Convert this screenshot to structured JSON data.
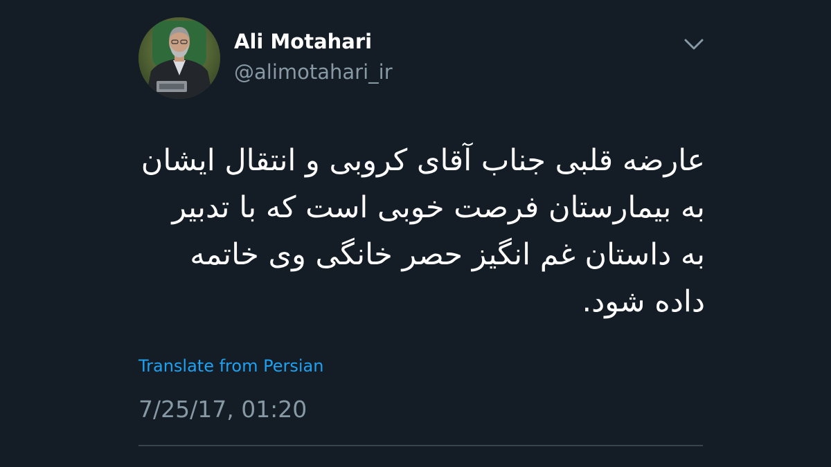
{
  "tweet": {
    "author": {
      "display_name": "Ali Motahari",
      "handle": "@alimotahari_ir",
      "avatar_icon": "profile-photo"
    },
    "menu_icon": "chevron-down-icon",
    "text": "عارضه قلبی جناب آقای کروبی و انتقال ایشان به بیمارستان فرصت خوبی است که با تدبیر به داستان غم انگیز حصر خانگی وی خاتمه داده شود.",
    "translate_label": "Translate from Persian",
    "timestamp": "7/25/17, 01:20"
  },
  "colors": {
    "background": "#141d26",
    "primary_text": "#ffffff",
    "secondary_text": "#8899a6",
    "link": "#1da1f2",
    "divider": "#38444d"
  }
}
